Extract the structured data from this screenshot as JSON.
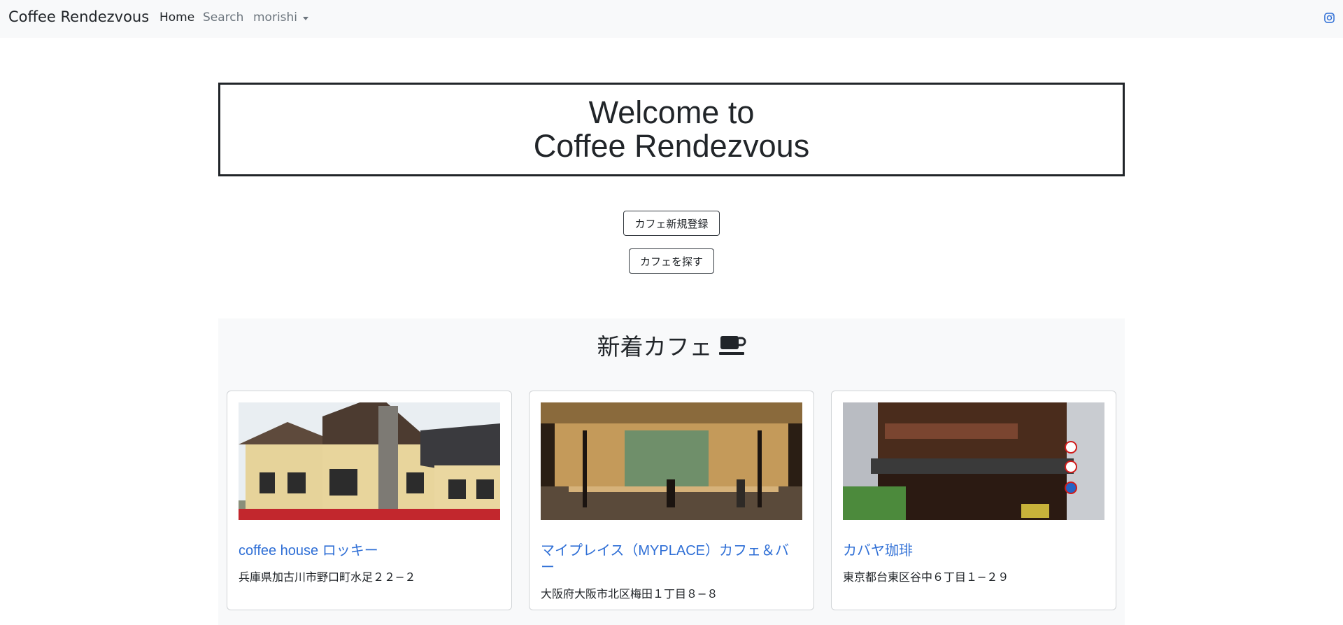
{
  "navbar": {
    "brand": "Coffee Rendezvous",
    "home": "Home",
    "search": "Search",
    "user": "morishi",
    "instagram_icon": "instagram-icon"
  },
  "hero": {
    "line1": "Welcome to",
    "line2": "Coffee Rendezvous"
  },
  "buttons": {
    "register": "カフェ新規登録",
    "find": "カフェを探す"
  },
  "new_cafes": {
    "title": "新着カフェ",
    "icon": "coffee-cup-icon",
    "cards": [
      {
        "name": "coffee house ロッキー",
        "address": "兵庫県加古川市野口町水足２２−２"
      },
      {
        "name": "マイプレイス（MYPLACE）カフェ＆バー",
        "address": "大阪府大阪市北区梅田１丁目８−８"
      },
      {
        "name": "カバヤ珈琲",
        "address": "東京都台東区谷中６丁目１−２９"
      }
    ]
  }
}
